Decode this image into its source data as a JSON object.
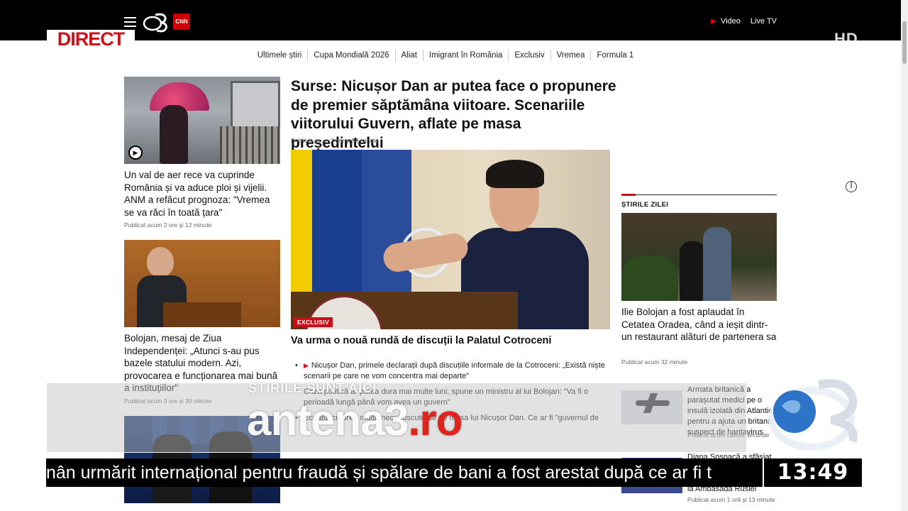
{
  "header": {
    "direct_badge": "DIRECT",
    "cnn_logo": "CNN",
    "hd_mark": "HD",
    "video_label": "Video",
    "live_label": "Live TV",
    "menu_icon": "hamburger-icon"
  },
  "subnav": [
    "Ultimele știri",
    "Cupa Mondială 2026",
    "Aliat",
    "Imigrant în România",
    "Exclusiv",
    "Vremea",
    "Formula 1"
  ],
  "left_column": [
    {
      "title": "Un val de aer rece va cuprinde România și va aduce ploi și vijelii. ANM a refăcut prognoza: \"Vremea se va răci în toată țara\"",
      "time": "Publicat acum 2 ore și 12 minute",
      "video_icon": "play-icon"
    },
    {
      "title": "Bolojan, mesaj de Ziua Independenței: „Atunci s-au pus bazele statului modern. Azi, provocarea e funcționarea mai bună a instituțiilor\"",
      "time": "Publicat acum 3 ore și 30 minute"
    }
  ],
  "main": {
    "title": "Surse: Nicușor Dan ar putea face o propunere de premier săptămâna viitoare. Scenariile viitorului Guvern, aflate pe masa președintelui",
    "time": "Publicat acum 2 ore și 53 minute",
    "badge": "EXCLUSIV",
    "subtitle": "Va urma o nouă rundă de discuții la Palatul Cotroceni",
    "bullets": [
      "Nicușor Dan, primele declarații după discuțiile informale de la Cotroceni: „Există niște scenarii pe care ne vom concentra mai departe\"",
      "Criza politică ar putea dura mai multe luni, spune un ministru al lui Bolojan: \"Va fi o perioadă lungă până vom avea un guvern\"",
      "Ecuația cu prea multe necunoscute de pe masa lui Nicușor Dan. Ce ar fi \"guvernul de"
    ]
  },
  "right_column": {
    "heading": "ȘTIRILE ZILEI",
    "featured_title": "Ilie Bolojan a fost aplaudat în Cetatea Oradea, când a ieșit dintr-un restaurant alături de partenera sa",
    "featured_time": "Publicat acum 32 minute",
    "items": [
      {
        "title": "Armata britanică a parașutat medici pe o insulă izolată din Atlantic pentru a ajuta un britanic suspect de hantavirus",
        "time": "Publicat acum câteva secunde"
      },
      {
        "title": "Diana Șoșoacă a sfâșiat un steag al UE la o manifestație, apoi a fost la Ambasada Rusiei",
        "time": "Publicat acum 1 oră și 13 minute"
      }
    ],
    "more_icon": "more-vertical-icon"
  },
  "promo": {
    "tagline": "ȘTIRILE SUNT AICI",
    "site_main": "antena3",
    "site_tld": ".ro"
  },
  "ticker": {
    "text": "nân urmărit internațional pentru fraudă și spălare de bani a fost arestat după ce ar fi t",
    "clock": "13:49"
  }
}
